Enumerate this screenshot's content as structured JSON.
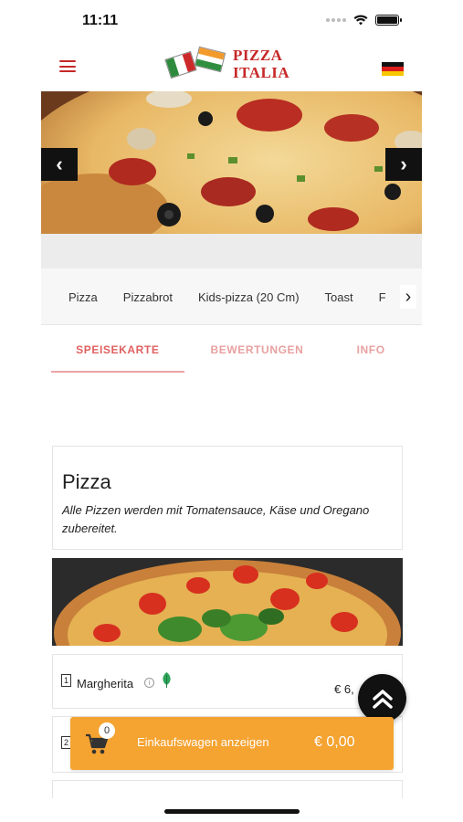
{
  "status_bar": {
    "time": "11:11",
    "icons": [
      "signal-icon",
      "wifi-icon",
      "battery-icon"
    ]
  },
  "header": {
    "logo_line1": "PIZZA",
    "logo_line2": "ITALIA",
    "menu_icon": "hamburger-menu-icon",
    "language_icon": "german-flag-icon"
  },
  "hero": {
    "prev_icon": "chevron-left-icon",
    "next_icon": "chevron-right-icon",
    "prev_glyph": "‹",
    "next_glyph": "›"
  },
  "categories": {
    "items": [
      "Pizza",
      "Pizzabrot",
      "Kids-pizza (20 Cm)",
      "Toast",
      "F"
    ],
    "next_glyph": "›"
  },
  "tabs": {
    "items": [
      "SPEISEKARTE",
      "BEWERTUNGEN",
      "INFO"
    ],
    "active_index": 0
  },
  "section": {
    "title": "Pizza",
    "description": "Alle Pizzen werden mit Tomatensauce, Käse und Oregano zubereitet."
  },
  "products": [
    {
      "number": "1",
      "name": "Margherita",
      "price": "€ 6,",
      "info_glyph": "i",
      "vegetarian_icon": "leaf-icon"
    },
    {
      "number": "2",
      "name": "",
      "price": ""
    }
  ],
  "cart": {
    "count": "0",
    "label": "Einkaufswagen anzeigen",
    "total": "€ 0,00",
    "icon": "shopping-cart-icon"
  },
  "colors": {
    "brand_red": "#c62828",
    "tab_active": "#e06060",
    "cart_orange": "#f5a331",
    "scroll_button": "#111111"
  }
}
